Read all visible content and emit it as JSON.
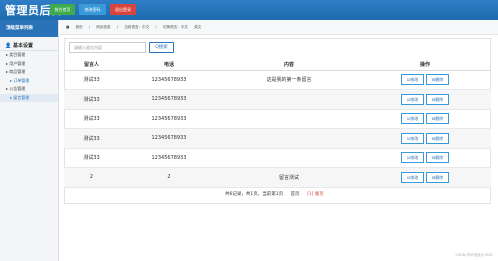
{
  "header": {
    "title": "管理员后台",
    "buttons": [
      "前台首页",
      "修改密码",
      "退出登录"
    ]
  },
  "sidebar": {
    "title": "顶级菜单列表",
    "section": "基本设置",
    "items": [
      "类目管理",
      "用户管理",
      "商品管理",
      "订单管理",
      "公告管理",
      "留言管理"
    ]
  },
  "breadcrumb": [
    "首页",
    "网站信息",
    "当前语言：中文",
    "切换语言：中文",
    "英文"
  ],
  "search": {
    "placeholder": "请输入留言内容",
    "button": "Q搜索"
  },
  "table": {
    "headers": [
      "留言人",
      "电话",
      "内容",
      "操作"
    ],
    "edit_label": "☑修改",
    "delete_label": "☒删除",
    "rows": [
      [
        "测试33",
        "12345678933",
        "这是我的第一条留言"
      ],
      [
        "测试33",
        "12345678933",
        ""
      ],
      [
        "测试33",
        "12345678933",
        ""
      ],
      [
        "测试33",
        "12345678933",
        ""
      ],
      [
        "测试33",
        "12345678933",
        ""
      ],
      [
        "2",
        "2",
        "留言测试"
      ]
    ]
  },
  "pagination": {
    "summary": "共6记录，共1页，当前第1页",
    "first": "首页",
    "last": "[1] 尾页"
  },
  "watermark": "CSDN @毕设设计1501"
}
